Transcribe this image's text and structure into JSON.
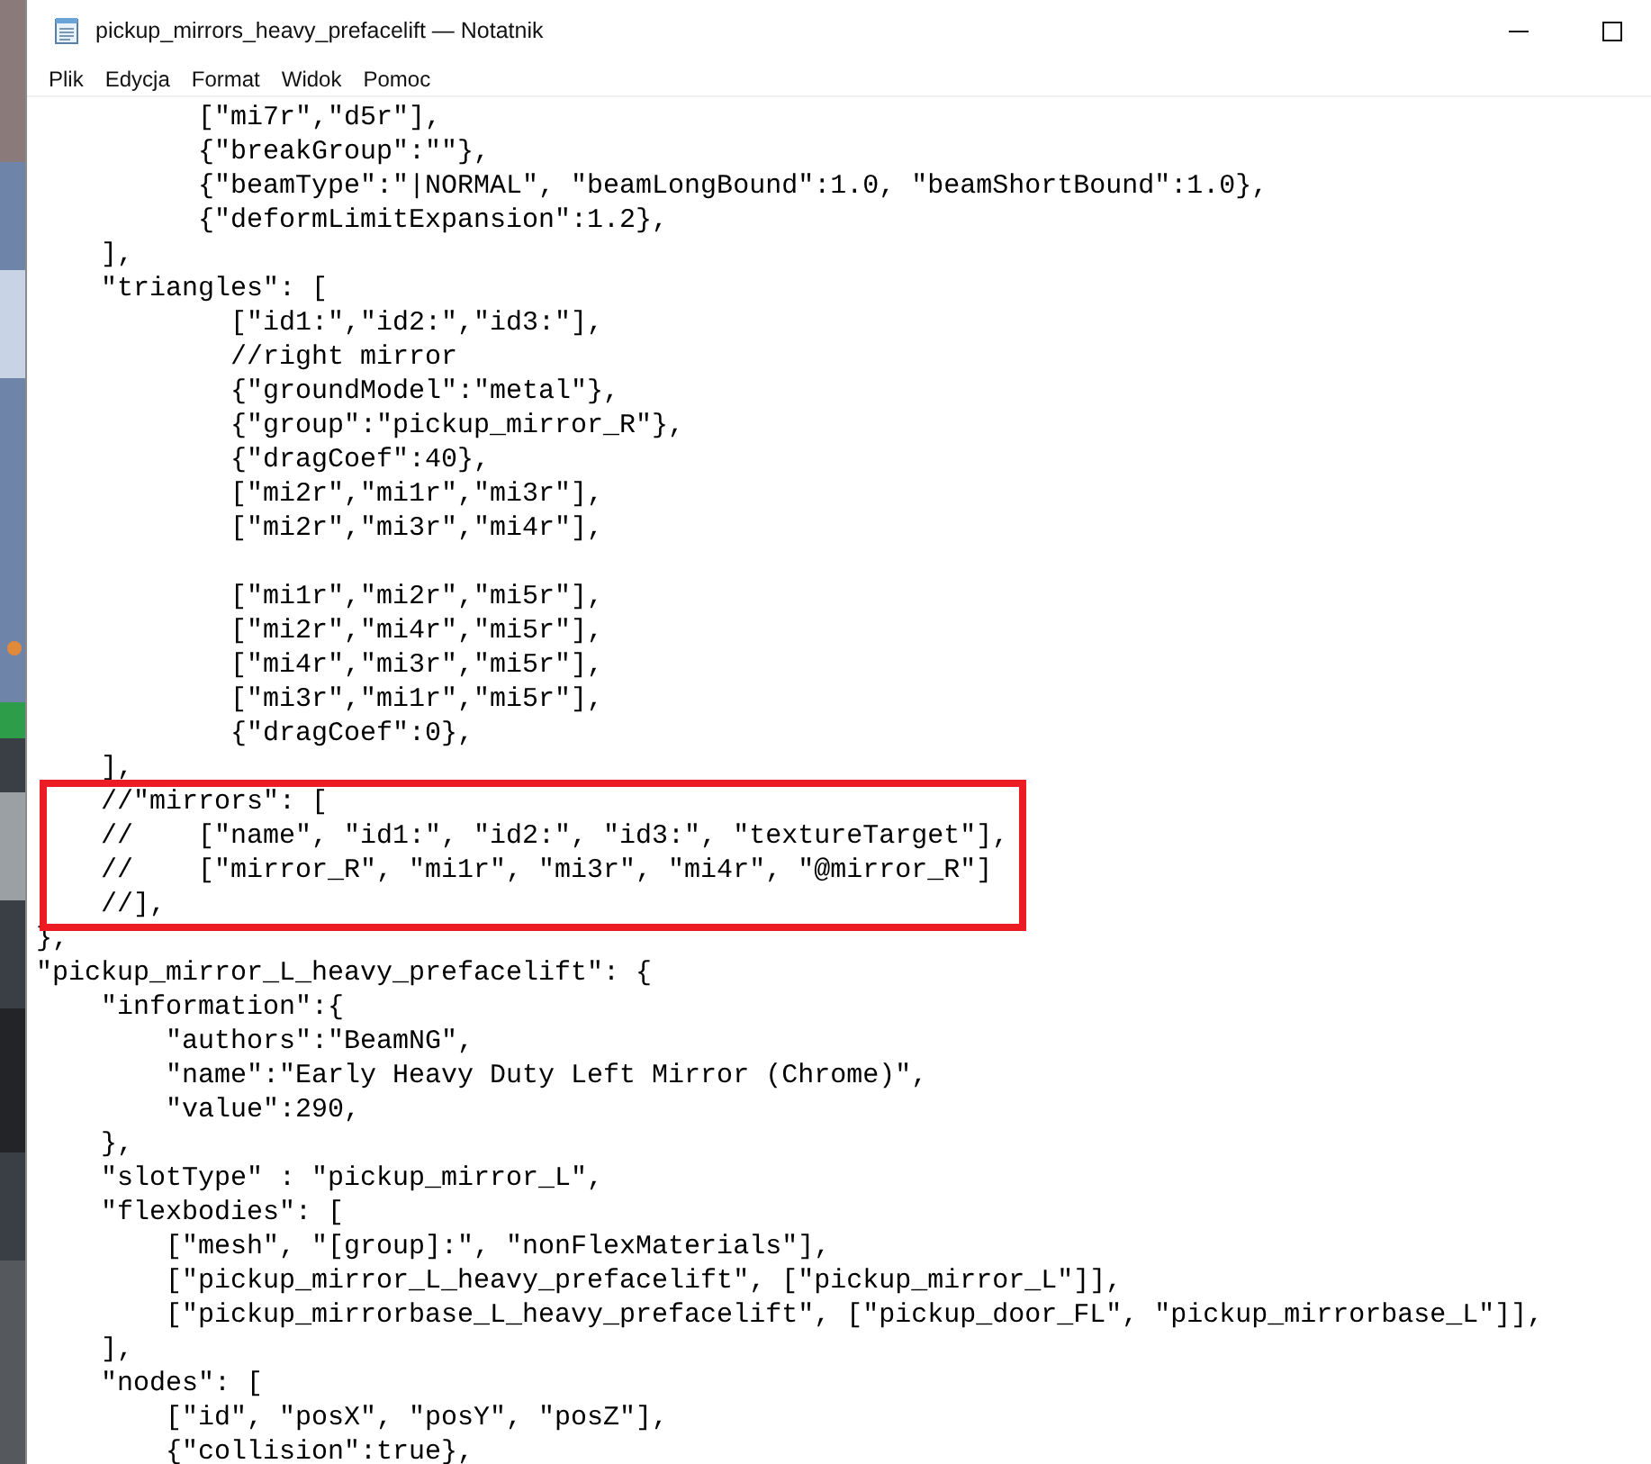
{
  "window": {
    "title": "pickup_mirrors_heavy_prefacelift — Notatnik",
    "controls": [
      {
        "kind": "minimize"
      },
      {
        "kind": "maximize"
      }
    ]
  },
  "menu": [
    "Plik",
    "Edycja",
    "Format",
    "Widok",
    "Pomoc"
  ],
  "lines": [
    {
      "kind": "code",
      "text": "          [\"mi7r\",\"d5r\"],"
    },
    {
      "kind": "code",
      "text": "          {\"breakGroup\":\"\"},"
    },
    {
      "kind": "code",
      "text": "          {\"beamType\":\"|NORMAL\", \"beamLongBound\":1.0, \"beamShortBound\":1.0},"
    },
    {
      "kind": "code",
      "text": "          {\"deformLimitExpansion\":1.2},"
    },
    {
      "kind": "code",
      "text": "    ],"
    },
    {
      "kind": "code",
      "text": "    \"triangles\": ["
    },
    {
      "kind": "code",
      "text": "            [\"id1:\",\"id2:\",\"id3:\"],"
    },
    {
      "kind": "code",
      "text": "            //right mirror"
    },
    {
      "kind": "code",
      "text": "            {\"groundModel\":\"metal\"},"
    },
    {
      "kind": "code",
      "text": "            {\"group\":\"pickup_mirror_R\"},"
    },
    {
      "kind": "code",
      "text": "            {\"dragCoef\":40},"
    },
    {
      "kind": "code",
      "text": "            [\"mi2r\",\"mi1r\",\"mi3r\"],"
    },
    {
      "kind": "code",
      "text": "            [\"mi2r\",\"mi3r\",\"mi4r\"],"
    },
    {
      "kind": "blank"
    },
    {
      "kind": "code",
      "text": "            [\"mi1r\",\"mi2r\",\"mi5r\"],"
    },
    {
      "kind": "code",
      "text": "            [\"mi2r\",\"mi4r\",\"mi5r\"],"
    },
    {
      "kind": "code",
      "text": "            [\"mi4r\",\"mi3r\",\"mi5r\"],"
    },
    {
      "kind": "code",
      "text": "            [\"mi3r\",\"mi1r\",\"mi5r\"],"
    },
    {
      "kind": "code",
      "text": "            {\"dragCoef\":0},"
    },
    {
      "kind": "code",
      "text": "    ],"
    },
    {
      "kind": "framed",
      "lines": [
        {
          "kind": "code",
          "text": "    //\"mirrors\": ["
        },
        {
          "kind": "code",
          "text": "    //    [\"name\", \"id1:\", \"id2:\", \"id3:\", \"textureTarget\"],"
        },
        {
          "kind": "code",
          "text": "    //    [\"mirror_R\", \"mi1r\", \"mi3r\", \"mi4r\", \"@mirror_R\"]"
        },
        {
          "kind": "code",
          "text": "    //],"
        }
      ]
    },
    {
      "kind": "code",
      "text": "},"
    },
    {
      "kind": "code",
      "text": "\"pickup_mirror_L_heavy_prefacelift\": {"
    },
    {
      "kind": "code",
      "text": "    \"information\":{"
    },
    {
      "kind": "code",
      "text": "        \"authors\":\"BeamNG\","
    },
    {
      "kind": "code",
      "text": "        \"name\":\"Early Heavy Duty Left Mirror (Chrome)\","
    },
    {
      "kind": "code",
      "text": "        \"value\":290,"
    },
    {
      "kind": "code",
      "text": "    },"
    },
    {
      "kind": "code",
      "text": "    \"slotType\" : \"pickup_mirror_L\","
    },
    {
      "kind": "code",
      "text": "    \"flexbodies\": ["
    },
    {
      "kind": "code",
      "text": "        [\"mesh\", \"[group]:\", \"nonFlexMaterials\"],"
    },
    {
      "kind": "code",
      "text": "        [\"pickup_mirror_L_heavy_prefacelift\", [\"pickup_mirror_L\"]],"
    },
    {
      "kind": "code",
      "text": "        [\"pickup_mirrorbase_L_heavy_prefacelift\", [\"pickup_door_FL\", \"pickup_mirrorbase_L\"]],"
    },
    {
      "kind": "code",
      "text": "    ],"
    },
    {
      "kind": "code",
      "text": "    \"nodes\": ["
    },
    {
      "kind": "code",
      "text": "        [\"id\", \"posX\", \"posY\", \"posZ\"],"
    },
    {
      "kind": "code",
      "text": "        {\"collision\":true},"
    }
  ]
}
